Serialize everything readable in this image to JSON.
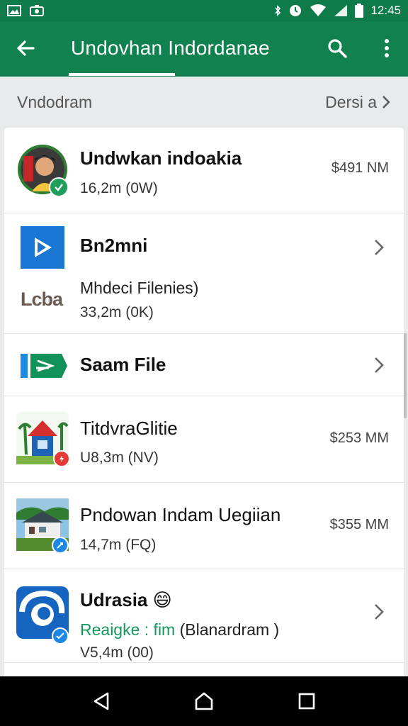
{
  "status_bar": {
    "time": "12:45",
    "icons": [
      "gallery-icon",
      "camera-icon",
      "bluetooth-icon",
      "alarm-icon",
      "wifi-icon",
      "signal-icon",
      "battery-icon"
    ]
  },
  "app_bar": {
    "title": "Undovhan  Indordanae",
    "back_icon": "arrow-left-icon",
    "search_icon": "search-icon",
    "more_icon": "more-vert-icon"
  },
  "section": {
    "title": "Vndodram",
    "action": "Dersi  a"
  },
  "list": [
    {
      "title": "Undwkan indoakia",
      "subtitle": "16,2m (0W)",
      "price": "$491 NM",
      "thumb": "avatar-photo",
      "badge_color": "#1e9e5a"
    },
    {
      "title": "Bn2mni",
      "line2": "Mhdeci Filenies)",
      "subtitle": "33,2m (0K)",
      "side_logo": "Lcba",
      "thumb": "play-app-icon"
    },
    {
      "title": "Saam File",
      "thumb": "flag-arrow-icon"
    },
    {
      "title": "TitdvraGlitie",
      "subtitle": "U8,3m (NV)",
      "price": "$253 MM",
      "thumb": "house-illustration",
      "badge_color": "#e53935"
    },
    {
      "title": "Pndowan Indam Uegiian",
      "subtitle": "14,7m (FQ)",
      "price": "$355 MM",
      "thumb": "house-photo",
      "badge_color": "#1e88e5"
    },
    {
      "title": "Udrasia",
      "emoji": "😄",
      "line2_green": "Reaigke : fim",
      "line2_rest": " (Blanardram )",
      "subtitle": "V5,4m (00)",
      "thumb": "blue-app-icon",
      "badge_color": "#1e88e5"
    }
  ],
  "colors": {
    "primary": "#10814f",
    "status": "#0f7a4a",
    "accent_green": "#14995c"
  },
  "nav": {
    "back_icon": "nav-back-icon",
    "home_icon": "nav-home-icon",
    "recents_icon": "nav-recents-icon"
  }
}
